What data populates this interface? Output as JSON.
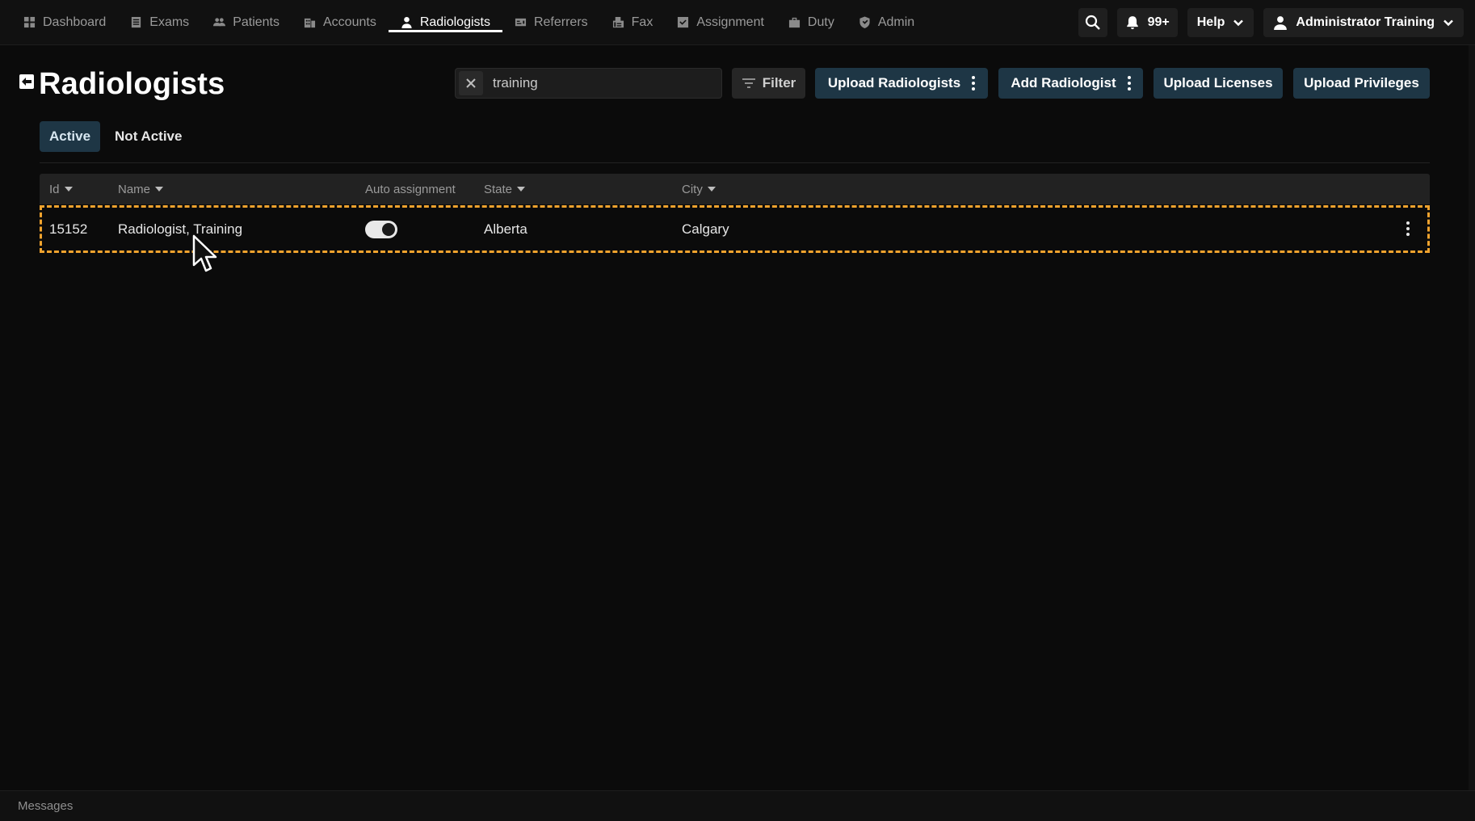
{
  "nav": {
    "items": [
      {
        "label": "Dashboard",
        "icon": "dashboard-icon",
        "active": false
      },
      {
        "label": "Exams",
        "icon": "exams-icon",
        "active": false
      },
      {
        "label": "Patients",
        "icon": "patients-icon",
        "active": false
      },
      {
        "label": "Accounts",
        "icon": "accounts-icon",
        "active": false
      },
      {
        "label": "Radiologists",
        "icon": "radiologist-icon",
        "active": true
      },
      {
        "label": "Referrers",
        "icon": "referrers-icon",
        "active": false
      },
      {
        "label": "Fax",
        "icon": "fax-icon",
        "active": false
      },
      {
        "label": "Assignment",
        "icon": "assignment-icon",
        "active": false
      },
      {
        "label": "Duty",
        "icon": "duty-icon",
        "active": false
      },
      {
        "label": "Admin",
        "icon": "admin-icon",
        "active": false
      }
    ],
    "notifications_count": "99+",
    "help_label": "Help",
    "user_label": "Administrator Training"
  },
  "page": {
    "title": "Radiologists",
    "search_value": "training",
    "filter_label": "Filter",
    "actions": {
      "upload_radiologists": "Upload Radiologists",
      "add_radiologist": "Add Radiologist",
      "upload_licenses": "Upload Licenses",
      "upload_privileges": "Upload Privileges"
    }
  },
  "tabs": {
    "active": "Active",
    "not_active": "Not Active"
  },
  "table": {
    "columns": {
      "id": "Id",
      "name": "Name",
      "auto_assignment": "Auto assignment",
      "state": "State",
      "city": "City"
    },
    "rows": [
      {
        "id": "15152",
        "name": "Radiologist, Training",
        "auto_assignment": true,
        "state": "Alberta",
        "city": "Calgary"
      }
    ]
  },
  "footer": {
    "messages_label": "Messages"
  },
  "colors": {
    "accent": "#1e3645",
    "selection_border": "#f0a32e",
    "background": "#0b0b0b"
  }
}
